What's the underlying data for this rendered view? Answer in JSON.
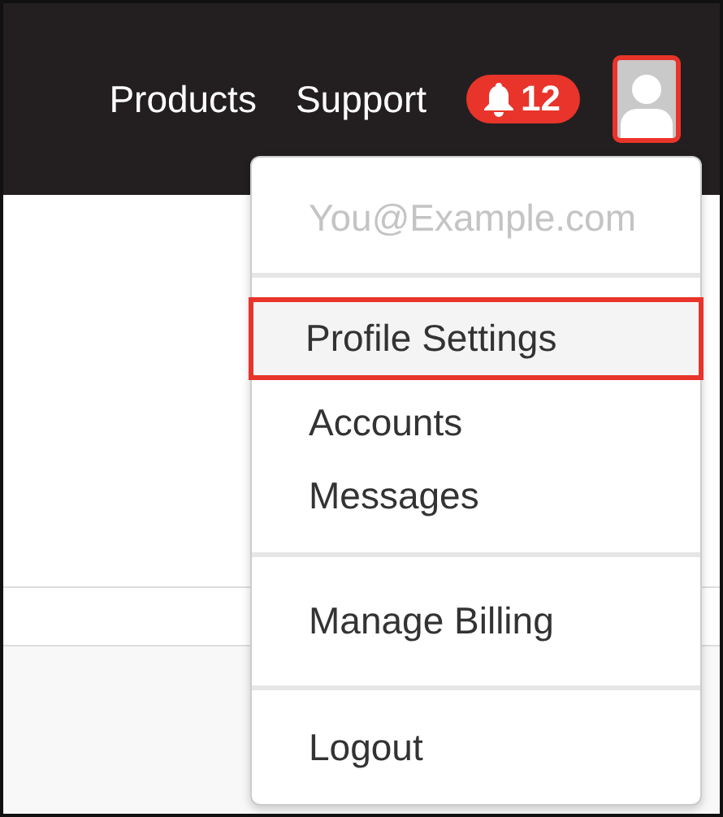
{
  "navbar": {
    "links": [
      "Products",
      "Support"
    ],
    "notifications": {
      "count": "12"
    },
    "avatar": {
      "highlighted": true
    }
  },
  "menu": {
    "email": "You@Example.com",
    "groups": [
      [
        {
          "label": "Profile Settings",
          "selected": true
        },
        {
          "label": "Accounts",
          "selected": false
        },
        {
          "label": "Messages",
          "selected": false
        }
      ],
      [
        {
          "label": "Manage Billing",
          "selected": false
        }
      ],
      [
        {
          "label": "Logout",
          "selected": false
        }
      ]
    ]
  }
}
